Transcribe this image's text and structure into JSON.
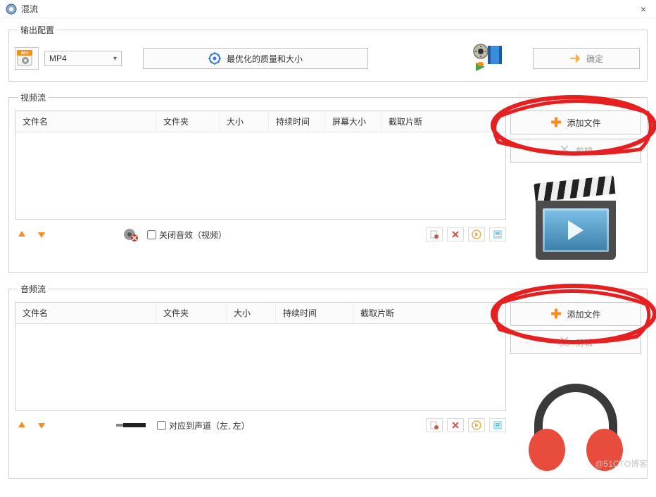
{
  "window": {
    "title": "混流",
    "close_glyph": "×"
  },
  "output": {
    "legend": "输出配置",
    "format_selected": "MP4",
    "quality_label": "最优化的质量和大小",
    "ok_label": "确定"
  },
  "video_stream": {
    "legend": "视频流",
    "columns": [
      "文件名",
      "文件夹",
      "大小",
      "持续时间",
      "屏幕大小",
      "截取片断"
    ],
    "mute_label": "关闭音效（视频）",
    "add_file_label": "添加文件",
    "trim_label": "剪辑"
  },
  "audio_stream": {
    "legend": "音频流",
    "columns": [
      "文件名",
      "文件夹",
      "大小",
      "持续时间",
      "截取片断"
    ],
    "channel_label": "对应到声道（左, 左）",
    "add_file_label": "添加文件",
    "trim_label": "剪辑"
  },
  "watermark": "@51CTO博客"
}
